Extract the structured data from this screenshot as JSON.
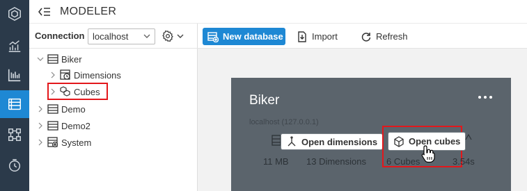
{
  "app": {
    "title": "MODELER"
  },
  "nav_rail": {
    "items": [
      "logo-icon",
      "analytics-icon",
      "reports-icon",
      "modeler-icon",
      "etl-icon",
      "scheduler-icon"
    ],
    "active": "modeler-icon"
  },
  "connection": {
    "label": "Connection",
    "selected": "localhost"
  },
  "tree": [
    {
      "label": "Biker",
      "expanded": true,
      "icon": "database-icon",
      "children": [
        {
          "label": "Dimensions",
          "icon": "dimensions-icon"
        },
        {
          "label": "Cubes",
          "icon": "cubes-icon",
          "highlighted": true
        }
      ]
    },
    {
      "label": "Demo",
      "icon": "database-icon"
    },
    {
      "label": "Demo2",
      "icon": "database-icon"
    },
    {
      "label": "System",
      "icon": "system-database-icon"
    }
  ],
  "toolbar": {
    "new_database": "New database",
    "import": "Import",
    "refresh": "Refresh"
  },
  "card": {
    "title": "Biker",
    "host": "localhost (127.0.0.1)",
    "open_dimensions": "Open dimensions",
    "open_cubes": "Open cubes",
    "stats": {
      "size": "11 MB",
      "dimensions": "13 Dimensions",
      "cubes": "6 Cubes",
      "time": "3.54s"
    }
  },
  "colors": {
    "rail_bg": "#2b3a4a",
    "accent": "#1e88d4",
    "card_bg": "#5b646c",
    "highlight": "#e3171b"
  }
}
